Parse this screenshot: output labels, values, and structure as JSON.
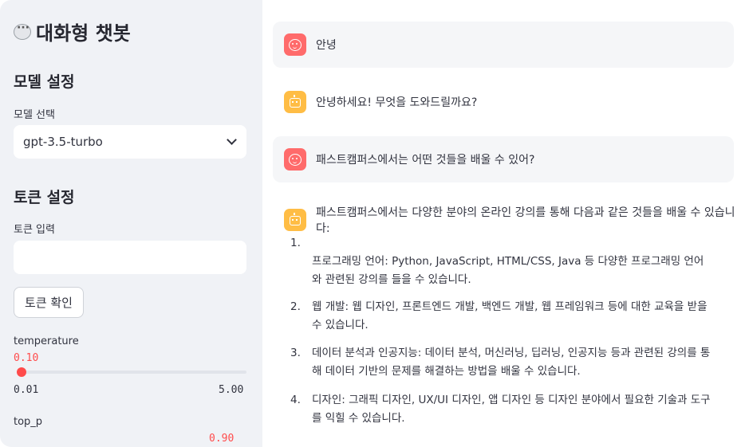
{
  "sidebar": {
    "title": "대화형 챗봇",
    "model_section": "모델 설정",
    "model_label": "모델 선택",
    "model_value": "gpt-3.5-turbo",
    "token_section": "토큰 설정",
    "token_label": "토큰 입력",
    "token_value": "",
    "token_button": "토큰 확인",
    "temperature": {
      "label": "temperature",
      "value": "0.10",
      "min": "0.01",
      "max": "5.00",
      "fraction": 0.018
    },
    "top_p": {
      "label": "top_p",
      "value": "0.90"
    }
  },
  "chat": {
    "messages": [
      {
        "role": "user",
        "text": "안녕"
      },
      {
        "role": "assistant",
        "text": "안녕하세요! 무엇을 도와드릴까요?"
      },
      {
        "role": "user",
        "text": "패스트캠퍼스에서는 어떤 것들을 배울 수 있어?"
      },
      {
        "role": "assistant",
        "text": "패스트캠퍼스에서는 다양한 분야의 온라인 강의를 통해 다음과 같은 것들을 배울 수 있습니다:"
      }
    ],
    "list": [
      {
        "num": "1.",
        "text": "프로그래밍 언어: Python, JavaScript, HTML/CSS, Java 등 다양한 프로그래밍 언어와 관련된 강의를 들을 수 있습니다."
      },
      {
        "num": "2.",
        "text": "웹 개발: 웹 디자인, 프론트엔드 개발, 백엔드 개발, 웹 프레임워크 등에 대한 교육을 받을 수 있습니다."
      },
      {
        "num": "3.",
        "text": "데이터 분석과 인공지능: 데이터 분석, 머신러닝, 딥러닝, 인공지능 등과 관련된 강의를 통해 데이터 기반의 문제를 해결하는 방법을 배울 수 있습니다."
      },
      {
        "num": "4.",
        "text": "디자인: 그래픽 디자인, UX/UI 디자인, 앱 디자인 등 디자인 분야에서 필요한 기술과 도구를 익힐 수 있습니다."
      }
    ]
  },
  "colors": {
    "accent": "#ff4b4b",
    "sidebar_bg": "#f0f2f6",
    "user_avatar": "#ff6b6b",
    "bot_avatar": "#ffbd45"
  }
}
